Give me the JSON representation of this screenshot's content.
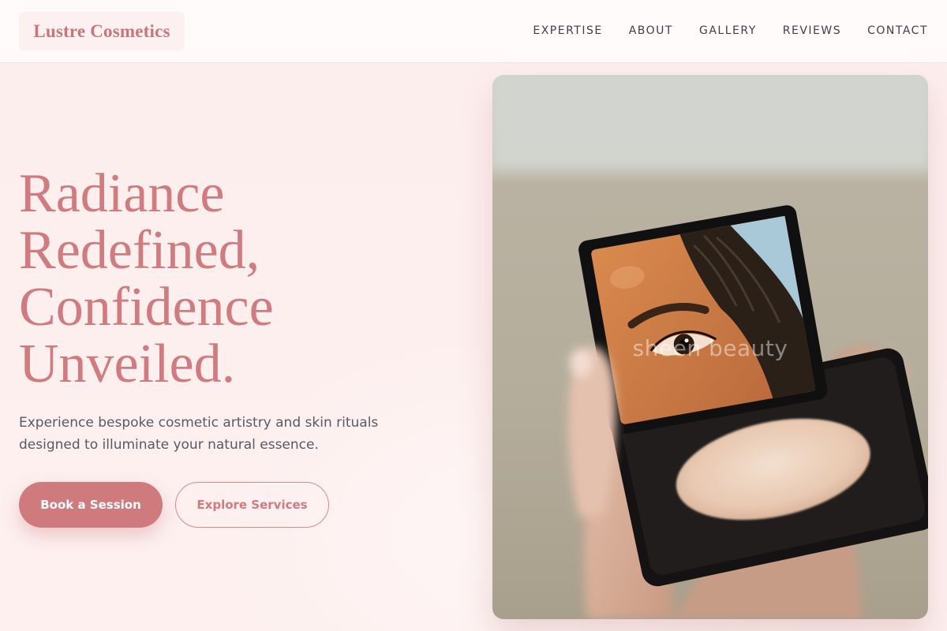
{
  "brand": {
    "name": "Lustre Cosmetics"
  },
  "nav": {
    "items": [
      {
        "label": "EXPERTISE"
      },
      {
        "label": "ABOUT"
      },
      {
        "label": "GALLERY"
      },
      {
        "label": "REVIEWS"
      },
      {
        "label": "CONTACT"
      }
    ]
  },
  "hero": {
    "title_lines": [
      "Radiance",
      "Redefined,",
      "Confidence",
      "Unveiled."
    ],
    "subtitle": "Experience bespoke cosmetic artistry and skin rituals designed to illuminate your natural essence.",
    "primary_cta": "Book a Session",
    "secondary_cta": "Explore Services",
    "image": {
      "subject": "hand-holding-compact-mirror-photo",
      "watermark": "sheen beauty"
    }
  },
  "colors": {
    "accent": "#cf7b7f",
    "background": "#fdeeee",
    "header_bg": "#fffbfb",
    "nav_text": "#3f3f46",
    "body_text": "#555a66"
  }
}
